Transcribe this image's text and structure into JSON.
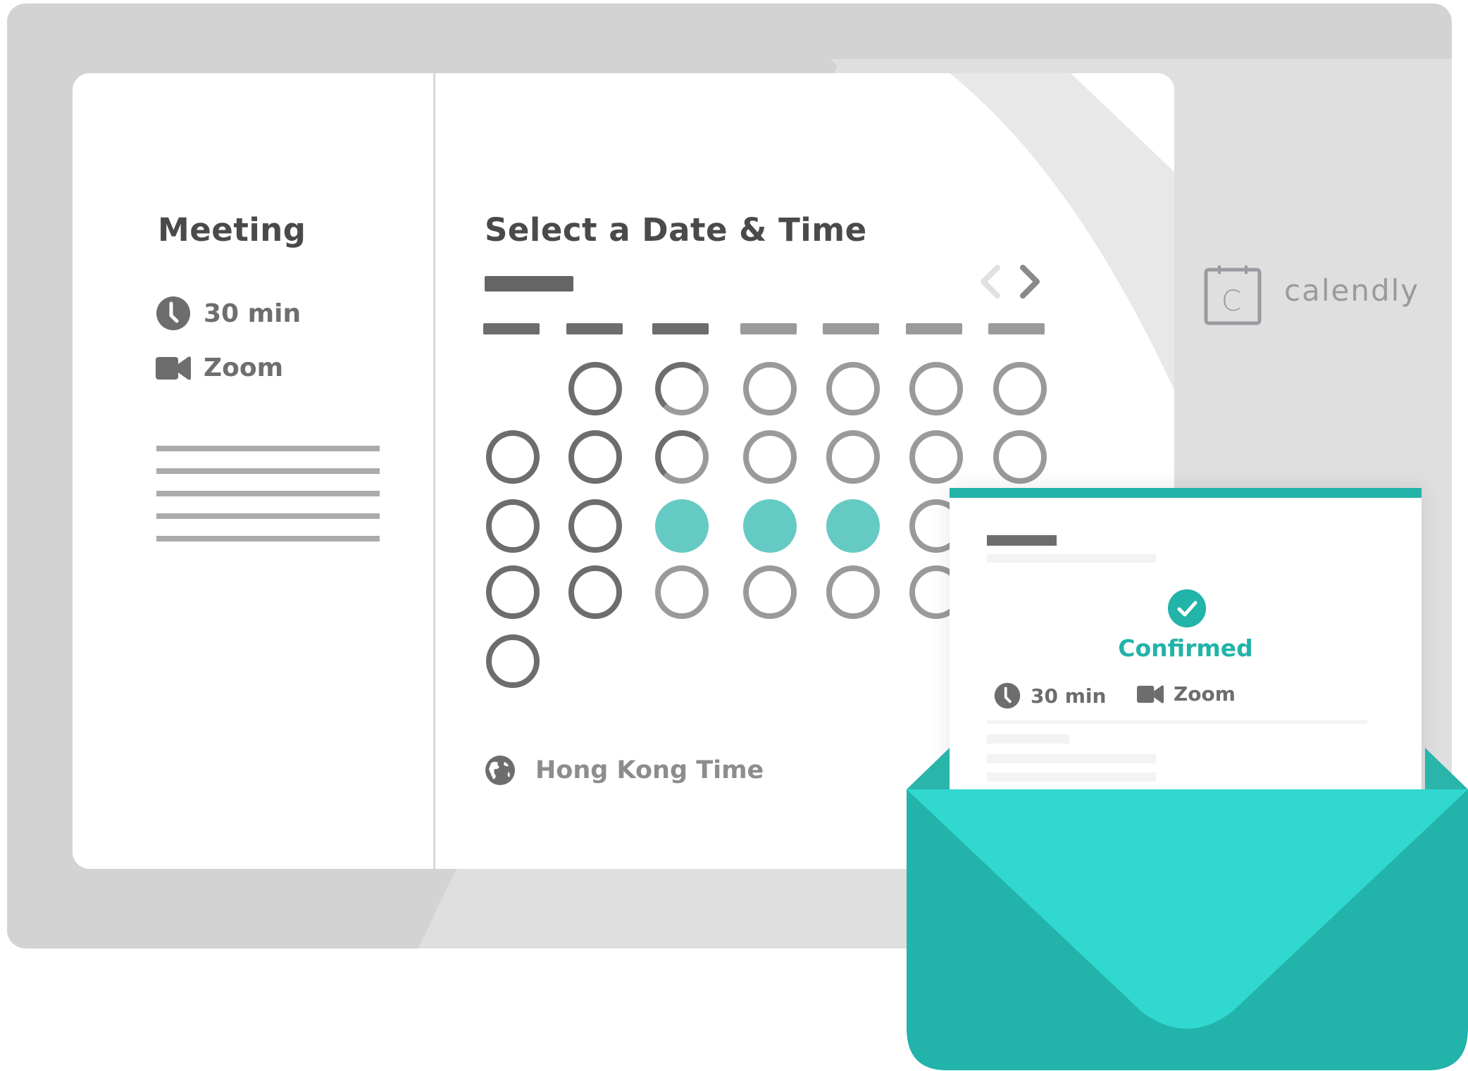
{
  "brand": {
    "logo_text": "calendly",
    "logo_icon_letter": "C",
    "logo_icon": "calendar-icon"
  },
  "colors": {
    "accent": "#22b3a9",
    "accent_light": "#31d8cf",
    "selected_day": "#66cac4",
    "frame": "#d3d3d3",
    "frame_light": "#dfdfdf",
    "text_dark": "#4a4a4a",
    "text_mid": "#6d6d6d"
  },
  "event": {
    "title": "Meeting",
    "duration": "30 min",
    "duration_icon": "clock-icon",
    "location": "Zoom",
    "location_icon": "video-camera-icon",
    "description_lines": 5
  },
  "scheduler": {
    "title": "Select a Date & Time",
    "nav_prev_icon": "chevron-left-icon",
    "nav_next_icon": "chevron-right-icon",
    "nav_prev_enabled": false,
    "nav_next_enabled": true,
    "weekday_headers": [
      {
        "state": "dark"
      },
      {
        "state": "dark"
      },
      {
        "state": "dark"
      },
      {
        "state": "light"
      },
      {
        "state": "light"
      },
      {
        "state": "light"
      },
      {
        "state": "light"
      }
    ],
    "weeks": [
      [
        "empty",
        "past",
        "split",
        "available",
        "available",
        "available",
        "available"
      ],
      [
        "past",
        "past",
        "split",
        "available",
        "available",
        "available",
        "available"
      ],
      [
        "past",
        "past",
        "selected",
        "selected",
        "selected",
        "available",
        "available"
      ],
      [
        "past",
        "past",
        "available",
        "available",
        "available",
        "available",
        "available"
      ],
      [
        "past",
        "empty",
        "empty",
        "empty",
        "empty",
        "empty",
        "empty"
      ]
    ],
    "timezone_icon": "globe-icon",
    "timezone": "Hong Kong Time"
  },
  "confirmation": {
    "status_icon": "check-circle-icon",
    "status": "Confirmed",
    "duration": "30 min",
    "location": "Zoom",
    "envelope_icon": "envelope-icon"
  }
}
